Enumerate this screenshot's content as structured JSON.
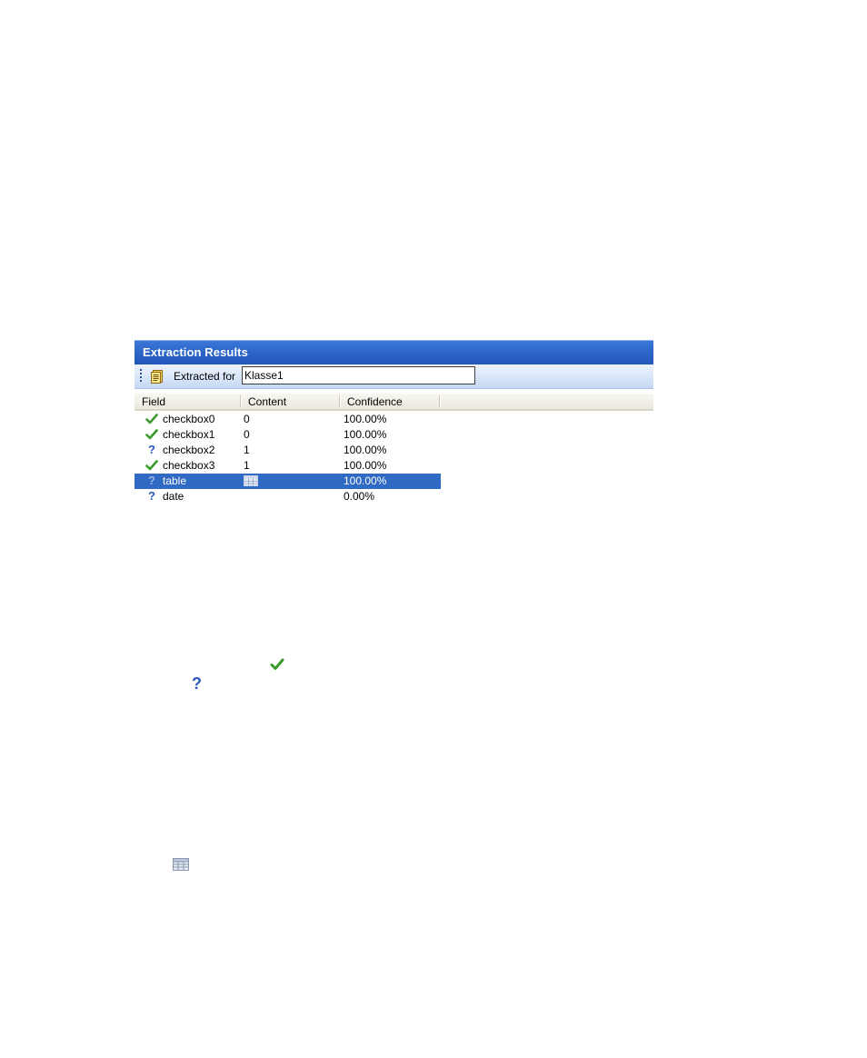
{
  "panel": {
    "title": "Extraction Results",
    "toolbar": {
      "label": "Extracted for",
      "value": "Klasse1",
      "icon": "document-icon"
    },
    "columns": [
      "Field",
      "Content",
      "Confidence"
    ],
    "rows": [
      {
        "status": "check",
        "field": "checkbox0",
        "content": "0",
        "confidence": "100.00%",
        "selected": false
      },
      {
        "status": "check",
        "field": "checkbox1",
        "content": "0",
        "confidence": "100.00%",
        "selected": false
      },
      {
        "status": "question",
        "field": "checkbox2",
        "content": "1",
        "confidence": "100.00%",
        "selected": false
      },
      {
        "status": "check",
        "field": "checkbox3",
        "content": "1",
        "confidence": "100.00%",
        "selected": false
      },
      {
        "status": "question",
        "field": "table",
        "content": "",
        "content_icon": "table-icon",
        "confidence": "100.00%",
        "selected": true
      },
      {
        "status": "question",
        "field": "date",
        "content": "",
        "confidence": "0.00%",
        "selected": false
      }
    ]
  },
  "legend": {
    "check_icon": "check-icon",
    "question_icon": "question-icon",
    "question_glyph": "?",
    "table_icon": "table-icon"
  },
  "colors": {
    "title_bar": "#2c63c6",
    "selection": "#316ac5",
    "check_green": "#3a9a2c",
    "question_blue": "#2b58b8"
  }
}
